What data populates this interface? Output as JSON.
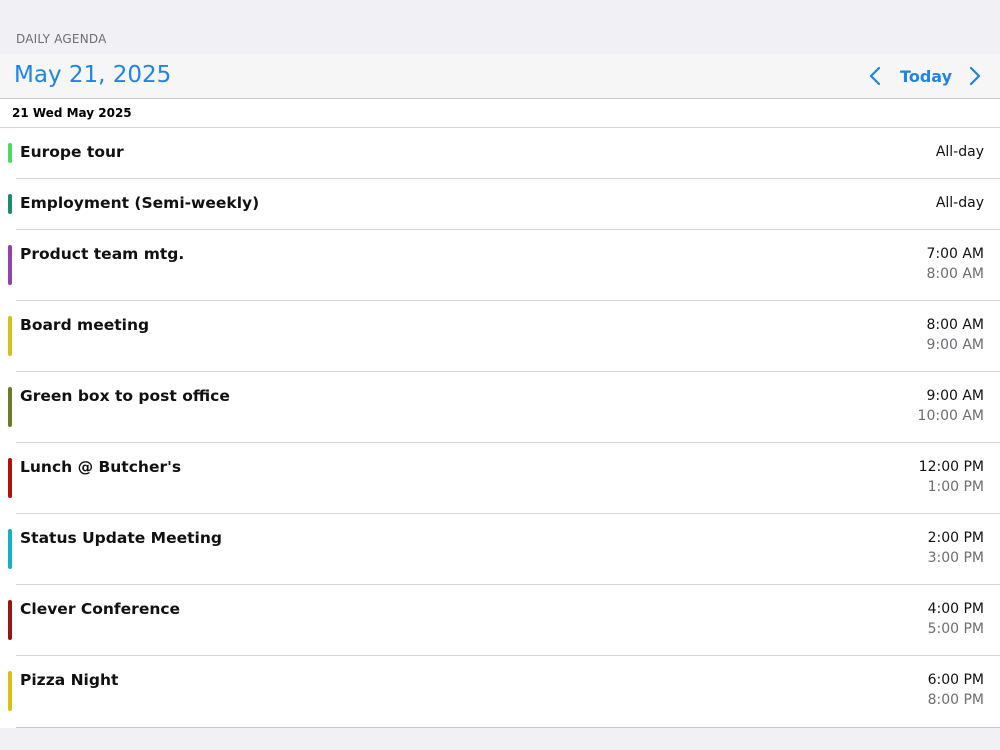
{
  "section_label": "DAILY AGENDA",
  "header": {
    "title": "May 21, 2025",
    "today_label": "Today",
    "prev_icon": "chevron-left-icon",
    "next_icon": "chevron-right-icon"
  },
  "colors": {
    "accent": "#1f84e6"
  },
  "day_header": "21 Wed May 2025",
  "events": [
    {
      "title": "Europe tour",
      "start": "All-day",
      "end": "",
      "color": "#4cd964",
      "all_day": true
    },
    {
      "title": "Employment (Semi-weekly)",
      "start": "All-day",
      "end": "",
      "color": "#1e8a6e",
      "all_day": true
    },
    {
      "title": "Product team mtg.",
      "start": "7:00 AM",
      "end": "8:00 AM",
      "color": "#8e44ad",
      "all_day": false
    },
    {
      "title": "Board meeting",
      "start": "8:00 AM",
      "end": "9:00 AM",
      "color": "#d4c01a",
      "all_day": false
    },
    {
      "title": "Green box to post office",
      "start": "9:00 AM",
      "end": "10:00 AM",
      "color": "#6b7a2a",
      "all_day": false
    },
    {
      "title": "Lunch @ Butcher's",
      "start": "12:00 PM",
      "end": "1:00 PM",
      "color": "#b01010",
      "all_day": false
    },
    {
      "title": "Status Update Meeting",
      "start": "2:00 PM",
      "end": "3:00 PM",
      "color": "#1aaec2",
      "all_day": false
    },
    {
      "title": "Clever Conference",
      "start": "4:00 PM",
      "end": "5:00 PM",
      "color": "#a11313",
      "all_day": false
    },
    {
      "title": "Pizza Night",
      "start": "6:00 PM",
      "end": "8:00 PM",
      "color": "#d8c018",
      "all_day": false
    }
  ]
}
